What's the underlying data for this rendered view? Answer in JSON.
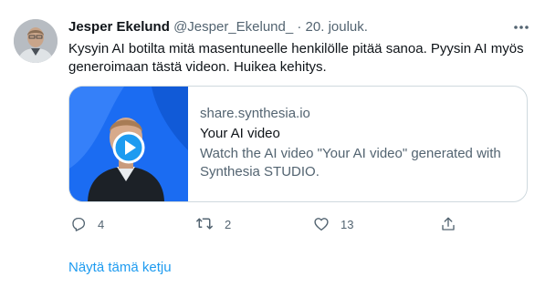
{
  "tweet": {
    "author": {
      "display_name": "Jesper Ekelund",
      "handle": "@Jesper_Ekelund_",
      "separator": "·",
      "date": "20. jouluk."
    },
    "more_icon": "more-horizontal-icon",
    "text": "Kysyin AI botilta mitä masentuneelle henkilölle pitää sanoa. Pyysin AI myös generoimaan tästä videon. Huikea kehitys.",
    "card": {
      "domain": "share.synthesia.io",
      "title": "Your AI video",
      "description": "Watch the AI video \"Your AI video\" generated with Synthesia STUDIO.",
      "thumbnail_icon": "play-icon"
    },
    "actions": {
      "reply": {
        "icon": "reply-icon",
        "count": "4"
      },
      "retweet": {
        "icon": "retweet-icon",
        "count": "2"
      },
      "like": {
        "icon": "heart-icon",
        "count": "13"
      },
      "share": {
        "icon": "share-icon"
      }
    },
    "show_thread": "Näytä tämä ketju"
  },
  "colors": {
    "text_primary": "#0f1419",
    "text_secondary": "#536471",
    "link": "#1d9bf0",
    "border": "#cfd9de",
    "thumbnail_bg": "#1b6cf2"
  }
}
